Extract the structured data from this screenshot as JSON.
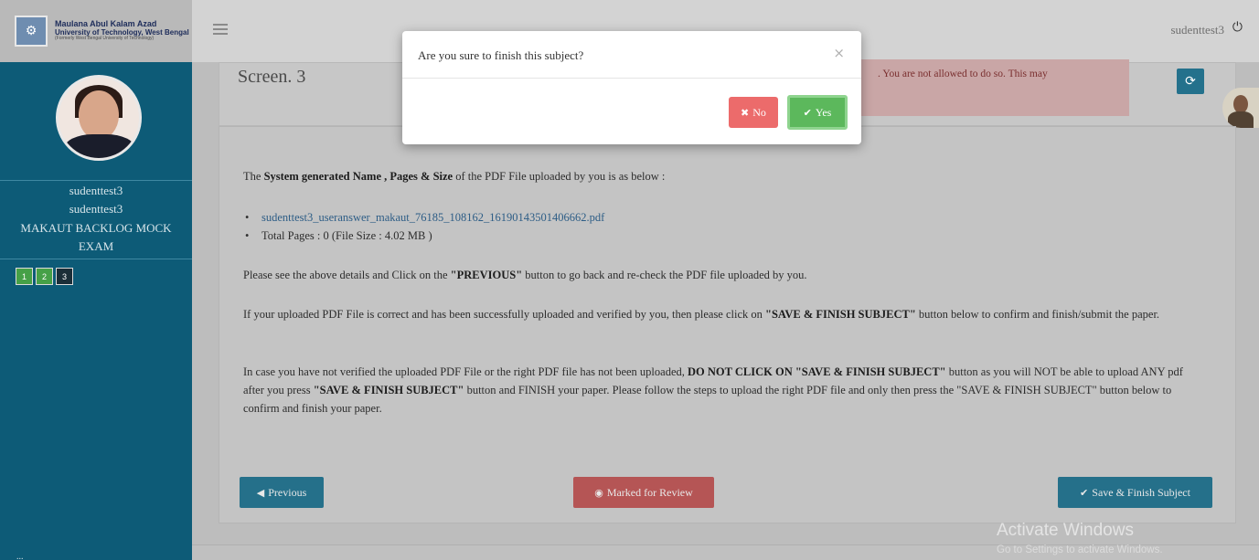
{
  "header": {
    "logo_line1": "Maulana Abul Kalam Azad",
    "logo_line2": "University of Technology, West Bengal",
    "logo_line3": "(Formerly West Bengal University of Technology)",
    "username": "sudenttest3",
    "icons": {
      "menu": "hamburger-icon",
      "logout": "power-icon"
    }
  },
  "sidebar": {
    "name": "sudenttest3",
    "id": "sudenttest3",
    "exam_line1": "MAKAUT BACKLOG MOCK",
    "exam_line2": "EXAM",
    "pages": [
      {
        "label": "1",
        "state": "answered"
      },
      {
        "label": "2",
        "state": "answered"
      },
      {
        "label": "3",
        "state": "current"
      }
    ],
    "bottom_text": "..."
  },
  "main": {
    "screen_title": "Screen. 3",
    "warning_text": ". You are not allowed to do so. This may",
    "intro_prefix": "The ",
    "intro_bold": "System generated Name , Pages & Size",
    "intro_suffix": " of the PDF File uploaded by you is as below :",
    "pdf_filename": "sudenttest3_useranswer_makaut_76185_108162_16190143501406662.pdf",
    "total_pages": "Total Pages : 0 (File Size : 4.02 MB )",
    "para1_a": "Please see the above details and Click on the ",
    "para1_b": "\"PREVIOUS\"",
    "para1_c": " button to go back and re-check the PDF file uploaded by you.",
    "para2_a": "If your uploaded PDF File is correct and has been successfully uploaded and verified by you, then please click on ",
    "para2_b": "\"SAVE & FINISH SUBJECT\"",
    "para2_c": " button below to confirm and finish/submit the paper.",
    "para3_a": "In case you have not verified the uploaded PDF File or the right PDF file has not been uploaded, ",
    "para3_b": "DO NOT CLICK ON \"SAVE & FINISH SUBJECT\"",
    "para3_c": " button as you will NOT be able to upload ANY pdf after you press ",
    "para3_d": "\"SAVE & FINISH SUBJECT\"",
    "para3_e": " button and FINISH your paper. Please follow the steps to upload the right PDF file and only then press the \"SAVE & FINISH SUBJECT\" button below to confirm and finish your paper.",
    "buttons": {
      "previous": "Previous",
      "mark_review": "Marked for Review",
      "save_finish": "Save & Finish Subject"
    }
  },
  "modal": {
    "title": "Are you sure to finish this subject?",
    "close": "×",
    "no_label": "No",
    "yes_label": "Yes"
  },
  "watermark": {
    "line1": "Activate Windows",
    "line2": "Go to Settings to activate Windows."
  },
  "colors": {
    "sidebar": "#0d5b77",
    "primary_button": "#25708a",
    "danger_button": "#b55555",
    "modal_no": "#ec6b6b",
    "modal_yes": "#5cb85c"
  }
}
